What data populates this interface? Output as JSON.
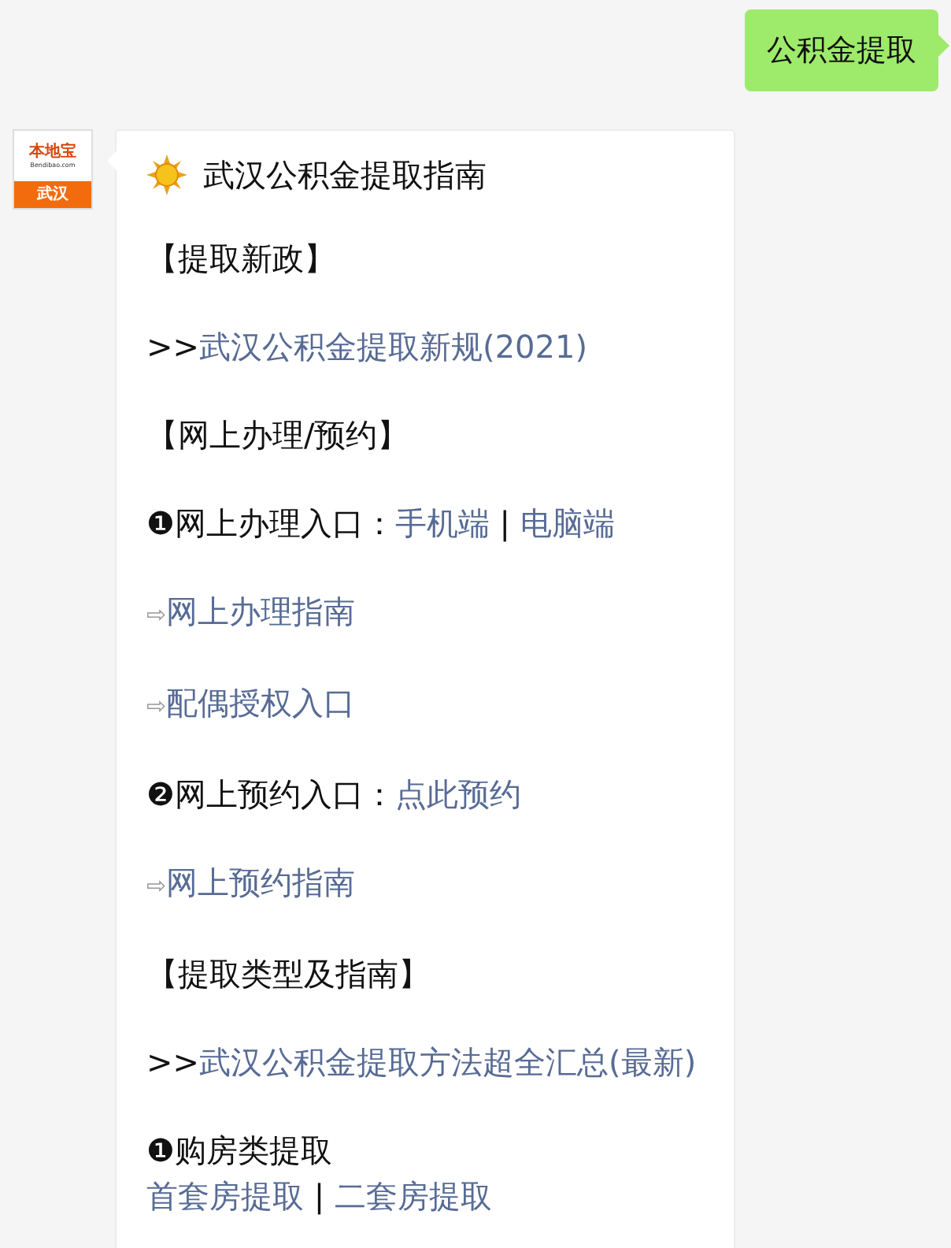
{
  "sent_message": {
    "text": "公积金提取"
  },
  "received_message": {
    "avatar": {
      "brand": "本地宝",
      "domain": "Bendibao.com",
      "city": "武汉"
    },
    "title": "武汉公积金提取指南",
    "paragraphs": [
      {
        "lines": [
          [
            {
              "kind": "text",
              "text": "【提取新政】"
            }
          ]
        ]
      },
      {
        "lines": [
          [
            {
              "kind": "text",
              "text": ">>"
            },
            {
              "kind": "link",
              "text": "武汉公积金提取新规(2021)"
            }
          ]
        ]
      },
      {
        "lines": [
          [
            {
              "kind": "text",
              "text": "【网上办理/预约】"
            }
          ]
        ]
      },
      {
        "lines": [
          [
            {
              "kind": "text",
              "text": "❶网上办理入口："
            },
            {
              "kind": "link",
              "text": "手机端"
            },
            {
              "kind": "text",
              "text": " | "
            },
            {
              "kind": "link",
              "text": "电脑端"
            }
          ]
        ]
      },
      {
        "lines": [
          [
            {
              "kind": "arrow",
              "text": "⇨"
            },
            {
              "kind": "link",
              "text": "网上办理指南"
            }
          ]
        ]
      },
      {
        "lines": [
          [
            {
              "kind": "arrow",
              "text": "⇨"
            },
            {
              "kind": "link",
              "text": "配偶授权入口"
            }
          ]
        ]
      },
      {
        "lines": [
          [
            {
              "kind": "text",
              "text": "❷网上预约入口："
            },
            {
              "kind": "link",
              "text": "点此预约"
            }
          ]
        ]
      },
      {
        "lines": [
          [
            {
              "kind": "arrow",
              "text": "⇨"
            },
            {
              "kind": "link",
              "text": "网上预约指南"
            }
          ]
        ]
      },
      {
        "lines": [
          [
            {
              "kind": "text",
              "text": "【提取类型及指南】"
            }
          ]
        ]
      },
      {
        "lines": [
          [
            {
              "kind": "text",
              "text": ">>"
            },
            {
              "kind": "link",
              "text": "武汉公积金提取方法超全汇总(最新)"
            }
          ]
        ]
      },
      {
        "lines": [
          [
            {
              "kind": "text",
              "text": "❶购房类提取"
            }
          ],
          [
            {
              "kind": "link",
              "text": "首套房提取"
            },
            {
              "kind": "text",
              "text": " | "
            },
            {
              "kind": "link",
              "text": "二套房提取"
            }
          ]
        ]
      }
    ]
  }
}
